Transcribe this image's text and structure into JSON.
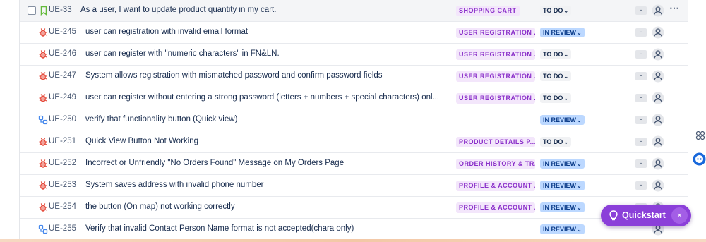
{
  "rows": [
    {
      "type": "story",
      "key": "UE-33",
      "summary": "As a user, I want to update product quantity in my cart.",
      "label": "SHOPPING CART",
      "status": "TO DO",
      "status_kind": "todo",
      "estimate": "-",
      "checkbox": true,
      "more": true
    },
    {
      "type": "bug",
      "key": "UE-245",
      "summary": "user can registration with invalid email format",
      "label": "USER REGISTRATION ...",
      "status": "IN REVIEW",
      "status_kind": "review",
      "estimate": "-"
    },
    {
      "type": "bug",
      "key": "UE-246",
      "summary": "user can register with \"numeric characters\" in FN&LN.",
      "label": "USER REGISTRATION ...",
      "status": "TO DO",
      "status_kind": "todo",
      "estimate": "-"
    },
    {
      "type": "bug",
      "key": "UE-247",
      "summary": "System allows registration with mismatched password and confirm password fields",
      "label": "USER REGISTRATION ...",
      "status": "TO DO",
      "status_kind": "todo",
      "estimate": "-"
    },
    {
      "type": "bug",
      "key": "UE-249",
      "summary": "user can register without entering a strong password (letters + numbers + special characters) onl...",
      "label": "USER REGISTRATION ...",
      "status": "TO DO",
      "status_kind": "todo",
      "estimate": "-"
    },
    {
      "type": "subtask",
      "key": "UE-250",
      "summary": "verify that functionality button (Quick view)",
      "label": "",
      "status": "IN REVIEW",
      "status_kind": "review",
      "estimate": "-"
    },
    {
      "type": "bug",
      "key": "UE-251",
      "summary": "Quick View Button Not Working",
      "label": "PRODUCT DETAILS P...",
      "status": "TO DO",
      "status_kind": "todo",
      "estimate": "-"
    },
    {
      "type": "bug",
      "key": "UE-252",
      "summary": "Incorrect or Unfriendly \"No Orders Found\" Message on My Orders Page",
      "label": "ORDER HISTORY & TR...",
      "status": "IN REVIEW",
      "status_kind": "review",
      "estimate": "-"
    },
    {
      "type": "bug",
      "key": "UE-253",
      "summary": "System saves address with invalid phone number",
      "label": "PROFILE & ACCOUNT ...",
      "status": "IN REVIEW",
      "status_kind": "review",
      "estimate": "-"
    },
    {
      "type": "bug",
      "key": "UE-254",
      "summary": "the button (On map) not working correctly",
      "label": "PROFILE & ACCOUNT ...",
      "status": "IN REVIEW",
      "status_kind": "review",
      "estimate": "-"
    },
    {
      "type": "subtask",
      "key": "UE-255",
      "summary": "Verify that invalid Contact Person Name format is not accepted(chara only)",
      "label": "",
      "status": "IN REVIEW",
      "status_kind": "review",
      "estimate": ""
    }
  ],
  "quickstart": {
    "label": "Quickstart",
    "close": "×"
  },
  "icons": {
    "story": "bookmark-icon",
    "bug": "bug-icon",
    "subtask": "subtask-icon",
    "assignee": "user-avatar-icon",
    "more": "more-icon",
    "apps": "apps-icon",
    "assistant": "assistant-icon",
    "lightbulb": "lightbulb-icon"
  },
  "colors": {
    "bug": "#e5493a",
    "story": "#63ba3c",
    "subtask": "#4688ec",
    "label_bg": "#f3e6fb",
    "label_text": "#8a2fc9",
    "review_bg": "#bcd8ff",
    "accent": "#8b3fd9"
  }
}
